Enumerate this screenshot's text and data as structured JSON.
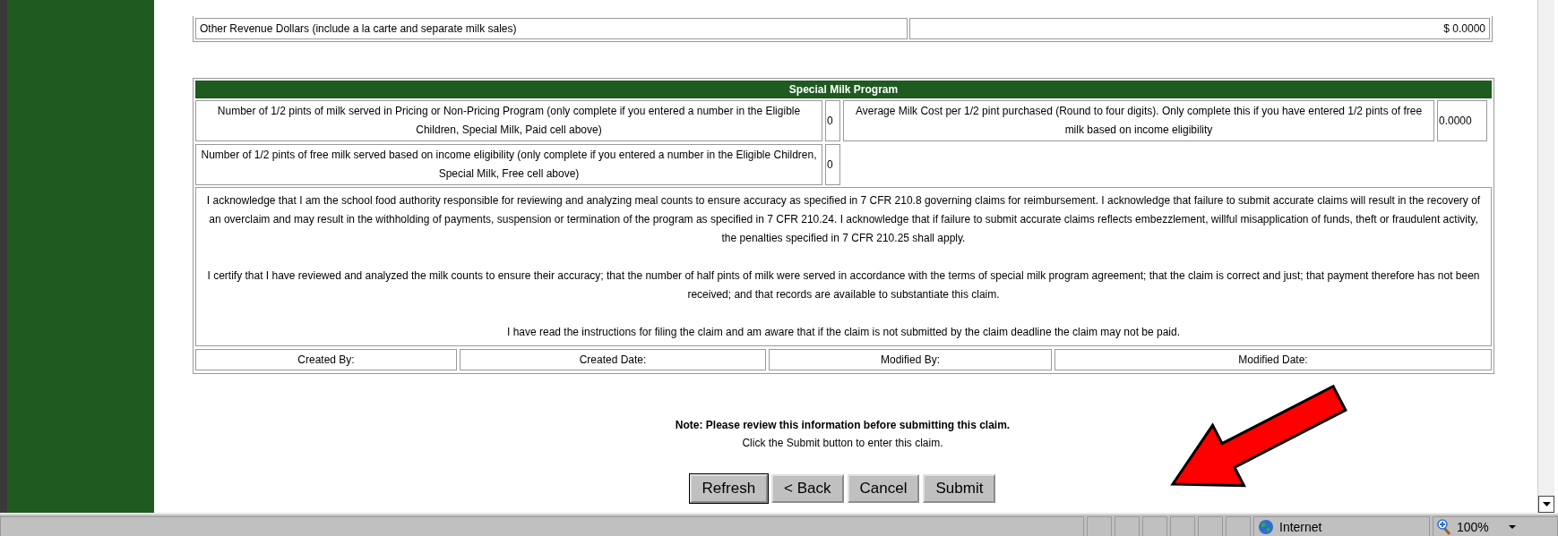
{
  "revenue_table": {
    "rows": [
      {
        "label": "Other Revenue Dollars (include a la carte and separate milk sales)",
        "values": [
          "$ 0.0000"
        ]
      }
    ]
  },
  "special_milk": {
    "title": "Special Milk Program",
    "fields": [
      {
        "label": "Number of 1/2 pints of milk served in Pricing or Non-Pricing Program (only complete if you entered a number in the Eligible Children, Special Milk, Paid cell above)",
        "value": "0"
      },
      {
        "label": "Average Milk Cost per 1/2 pint purchased (Round to four digits). Only complete this if you have entered 1/2 pints of free milk based on income eligibility",
        "value": "0.0000"
      },
      {
        "label": "Number of 1/2 pints of free milk served based on income eligibility (only complete if you entered a number in the Eligible Children, Special Milk, Free cell above)",
        "value": "0"
      }
    ],
    "certification": [
      "I acknowledge that I am the school food authority responsible for reviewing and analyzing meal counts to ensure accuracy as specified in 7 CFR 210.8 governing claims for reimbursement. I acknowledge that failure to submit accurate claims will result in the recovery of an overclaim and may result in the withholding of payments, suspension or termination of the program as specified in 7 CFR 210.24. I acknowledge that if failure to submit accurate claims reflects embezzlement, willful misapplication of funds, theft or fraudulent activity, the penalties specified in 7 CFR 210.25 shall apply.",
      "I certify that I have reviewed and analyzed the milk counts to ensure their accuracy; that the number of half pints of milk were served in accordance with the terms of special milk program agreement; that the claim is correct and just; that payment therefore has not been received; and that records are available to substantiate this claim.",
      "I have read the instructions for filing the claim and am aware that if the claim is not submitted by the claim deadline the claim may not be paid."
    ],
    "audit": [
      "Created By:",
      "Created Date:",
      "Modified By:",
      "Modified Date:"
    ]
  },
  "note": "Note: Please review this information before submitting this claim.",
  "instruction": "Click the Submit button to enter this claim.",
  "buttons": [
    {
      "label": "Refresh",
      "default": true
    },
    {
      "label": "< Back",
      "default": false
    },
    {
      "label": "Cancel",
      "default": false
    },
    {
      "label": "Submit",
      "default": false
    }
  ],
  "status_bar": {
    "zone": "Internet",
    "zoom": "100%"
  }
}
